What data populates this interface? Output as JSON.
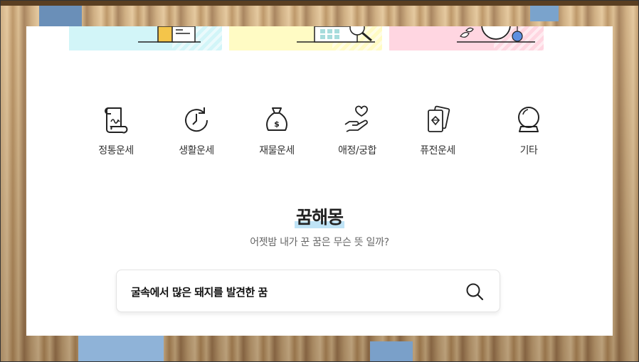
{
  "categories": [
    {
      "label": "정통운세",
      "icon": "scroll-icon"
    },
    {
      "label": "생활운세",
      "icon": "clock-refresh-icon"
    },
    {
      "label": "재물운세",
      "icon": "money-bag-icon"
    },
    {
      "label": "애정/궁합",
      "icon": "heart-hand-icon"
    },
    {
      "label": "퓨전운세",
      "icon": "cards-icon"
    },
    {
      "label": "기타",
      "icon": "crystal-ball-icon"
    }
  ],
  "dream": {
    "title": "꿈해몽",
    "subtitle": "어젯밤 내가 꾼 꿈은 무슨 뜻 일까?",
    "search_value": "굴속에서 많은 돼지를 발견한 꿈",
    "search_icon": "search-icon"
  },
  "colors": {
    "banner_cyan": "#d2f5f8",
    "banner_yellow": "#fffbc4",
    "banner_pink": "#ffd6e1",
    "title_highlight": "#bfe3f6"
  }
}
